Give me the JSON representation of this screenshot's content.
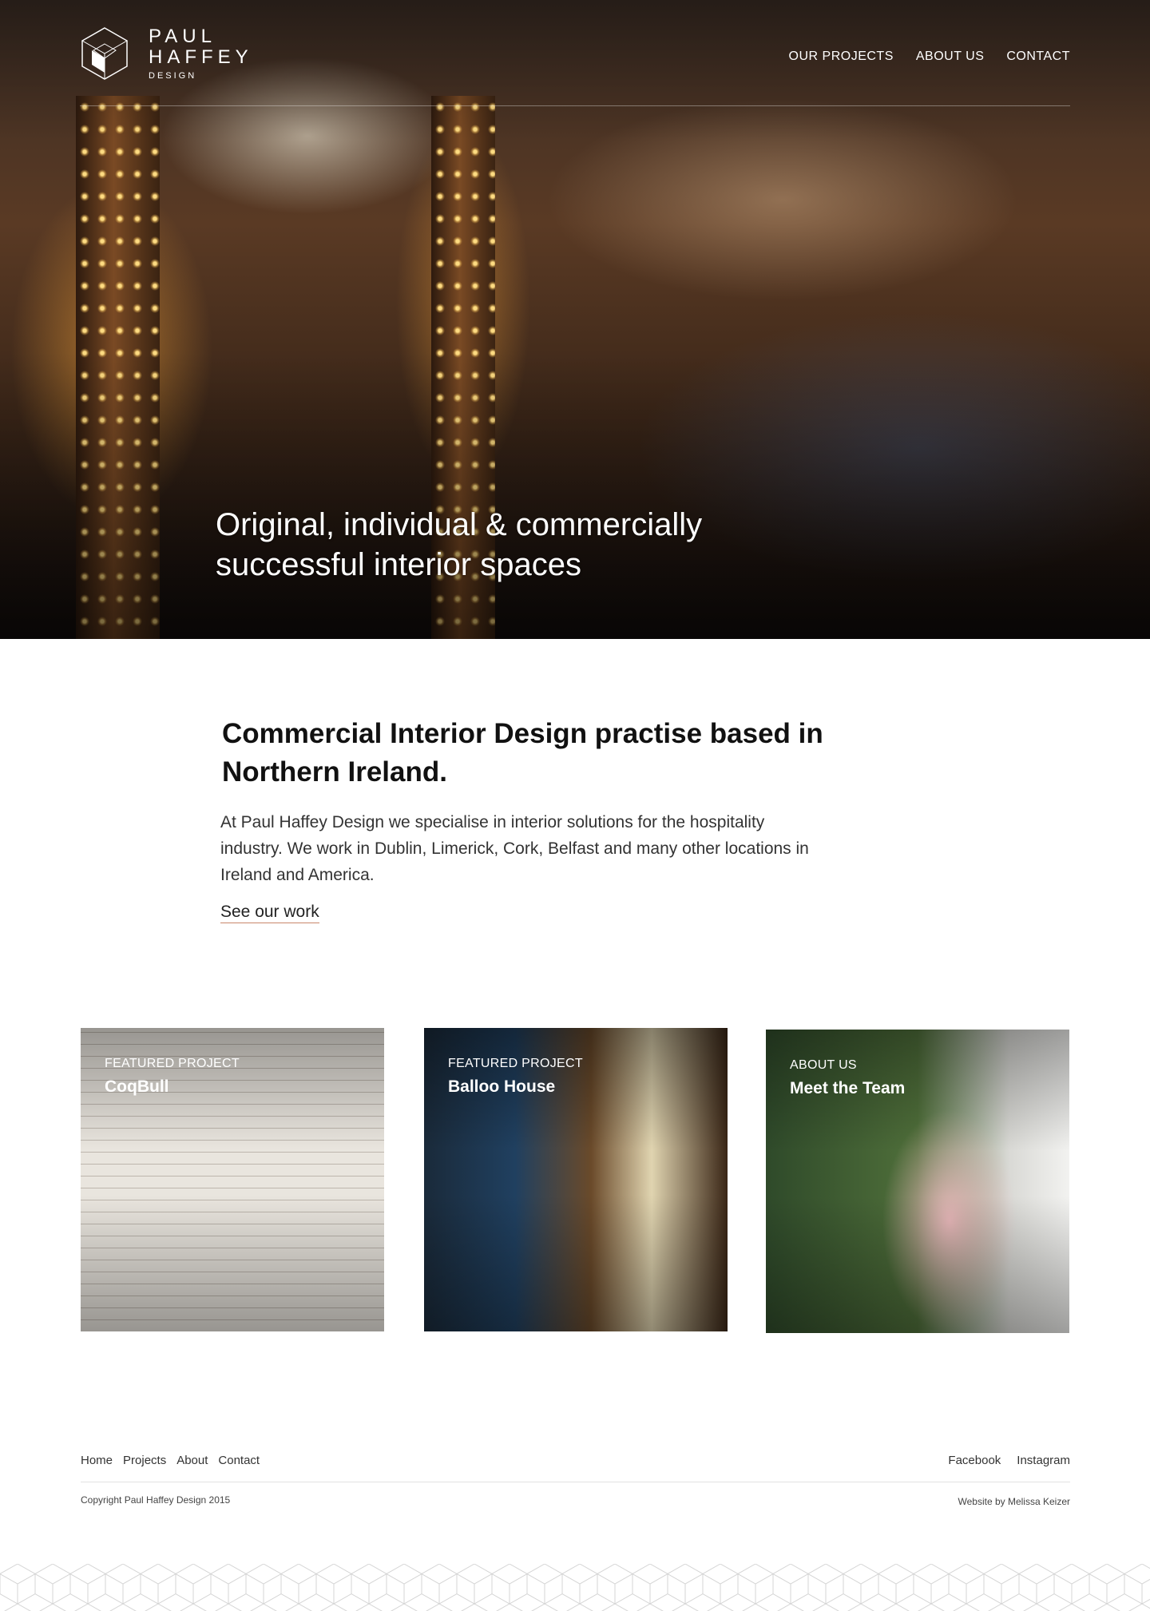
{
  "brand": {
    "line1": "PAUL",
    "line2": "HAFFEY",
    "line3": "DESIGN",
    "logo_icon": "cube-logo-icon"
  },
  "nav": {
    "items": [
      {
        "label": "OUR PROJECTS"
      },
      {
        "label": "ABOUT US"
      },
      {
        "label": "CONTACT"
      }
    ]
  },
  "hero": {
    "headline": "Original, individual & commercially successful interior spaces"
  },
  "intro": {
    "heading": "Commercial Interior Design practise based in Northern Ireland.",
    "body": "At Paul Haffey Design we specialise in interior solutions for the hospitality industry. We work in Dublin, Limerick, Cork, Belfast and many other locations in Ireland and America.",
    "cta": "See our work",
    "accent_color": "#c9876a"
  },
  "cards": [
    {
      "eyebrow": "FEATURED PROJECT",
      "title": "CoqBull"
    },
    {
      "eyebrow": "FEATURED PROJECT",
      "title": "Balloo House"
    },
    {
      "eyebrow": "ABOUT US",
      "title": "Meet the Team"
    }
  ],
  "footer": {
    "nav": [
      {
        "label": "Home"
      },
      {
        "label": "Projects"
      },
      {
        "label": "About"
      },
      {
        "label": "Contact"
      }
    ],
    "social": [
      {
        "label": "Facebook"
      },
      {
        "label": "Instagram"
      }
    ],
    "copyright": "Copyright Paul Haffey Design 2015",
    "credit": "Website by Melissa Keizer"
  }
}
